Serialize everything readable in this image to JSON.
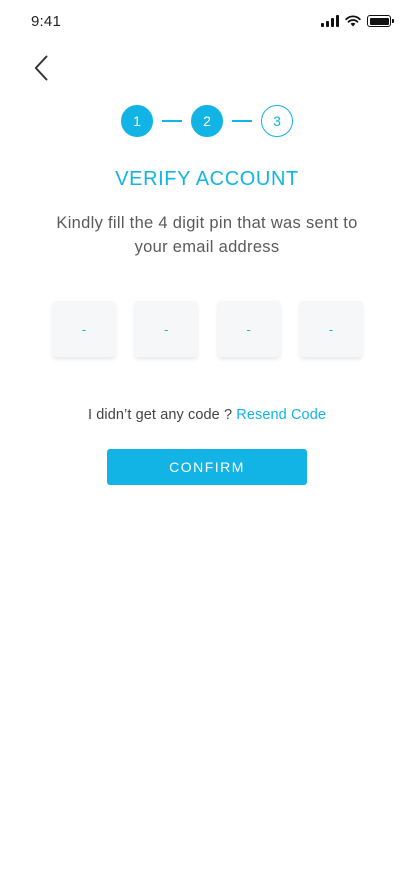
{
  "status_bar": {
    "time": "9:41"
  },
  "stepper": {
    "steps": [
      "1",
      "2",
      "3"
    ]
  },
  "title": "VERIFY ACCOUNT",
  "subtitle": "Kindly fill the 4 digit pin that was sent to your email address",
  "pin_fields": {
    "placeholders": [
      "-",
      "-",
      "-",
      "-"
    ]
  },
  "resend": {
    "prompt": "I didn’t get any code ? ",
    "link_label": "Resend Code"
  },
  "confirm_label": "CONFIRM",
  "colors": {
    "accent": "#12b4e6",
    "text": "#5a5a5a",
    "pin_bg": "#f6f7f8"
  },
  "icons": {
    "back": "chevron-left-icon",
    "signal": "cellular-signal-icon",
    "wifi": "wifi-icon",
    "battery": "battery-icon"
  }
}
